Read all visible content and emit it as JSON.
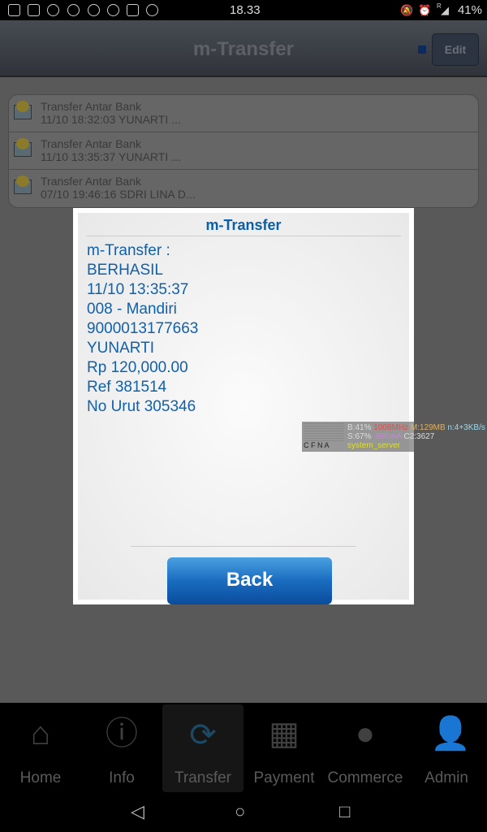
{
  "status_bar": {
    "time": "18.33",
    "battery": "41%",
    "roaming": "R"
  },
  "header": {
    "title": "m-Transfer",
    "edit_label": "Edit"
  },
  "list": [
    {
      "title": "Transfer Antar Bank",
      "subtitle": "11/10 18:32:03 YUNARTI    ..."
    },
    {
      "title": "Transfer Antar Bank",
      "subtitle": "11/10 13:35:37 YUNARTI    ..."
    },
    {
      "title": "Transfer Antar Bank",
      "subtitle": "07/10 19:46:16 SDRI LINA D..."
    }
  ],
  "dialog": {
    "title": "m-Transfer",
    "lines": [
      "m-Transfer :",
      "BERHASIL",
      "11/10 13:35:37",
      "008 - Mandiri",
      "9000013177663",
      "YUNARTI",
      "Rp 120,000.00",
      "Ref 381514",
      "No Urut 305346"
    ],
    "back_label": "Back"
  },
  "overlay": {
    "bar_labels": "C F N A",
    "line1a": "B:41%",
    "line1b": "1008MHz",
    "line1c": "M:129MB",
    "line1d": "n:4+3KB/s",
    "line2a": "S:67%",
    "line2b": "-685mA",
    "line2c": "C2:3627",
    "line3": "system_server"
  },
  "nav": {
    "items": [
      {
        "label": "Home",
        "icon": "home-icon"
      },
      {
        "label": "Info",
        "icon": "info-icon"
      },
      {
        "label": "Transfer",
        "icon": "transfer-icon",
        "active": true
      },
      {
        "label": "Payment",
        "icon": "payment-icon"
      },
      {
        "label": "Commerce",
        "icon": "commerce-icon"
      },
      {
        "label": "Admin",
        "icon": "admin-icon"
      }
    ]
  },
  "colors": {
    "accent": "#0b5ea8",
    "button": "#1a6cc0"
  }
}
